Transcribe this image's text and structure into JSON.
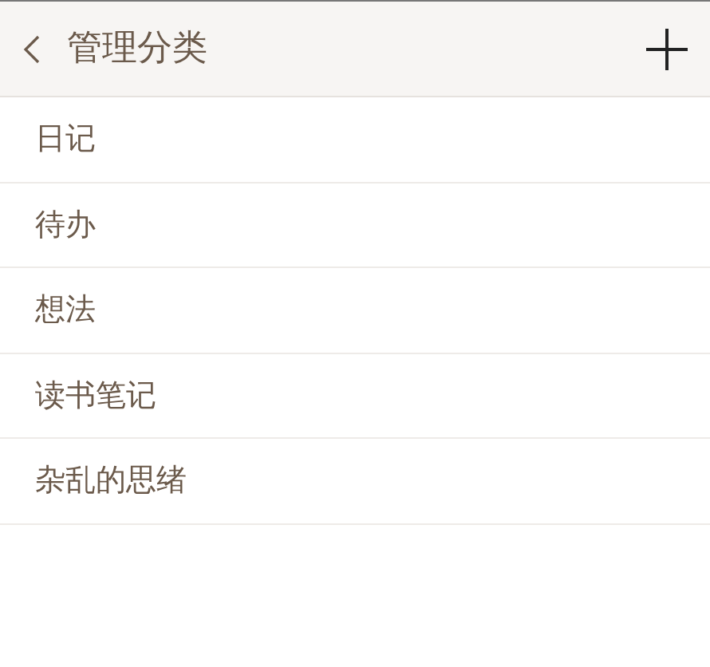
{
  "header": {
    "title": "管理分类"
  },
  "categories": [
    {
      "label": "日记"
    },
    {
      "label": "待办"
    },
    {
      "label": "想法"
    },
    {
      "label": "读书笔记"
    },
    {
      "label": "杂乱的思绪"
    }
  ]
}
